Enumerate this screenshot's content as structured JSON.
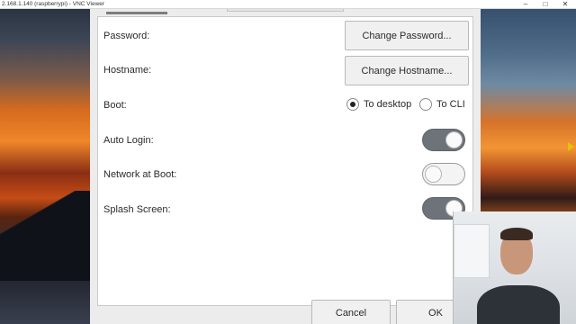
{
  "window": {
    "title": "2.168.1.140 (raspberrypi) - VNC Viewer",
    "minimize": "–",
    "maximize": "□",
    "close": "✕"
  },
  "settings": {
    "password_label": "Password:",
    "password_button": "Change Password...",
    "hostname_label": "Hostname:",
    "hostname_button": "Change Hostname...",
    "boot_label": "Boot:",
    "boot_options": [
      {
        "label": "To desktop",
        "selected": true
      },
      {
        "label": "To CLI",
        "selected": false
      }
    ],
    "auto_login_label": "Auto Login:",
    "auto_login": true,
    "network_boot_label": "Network at Boot:",
    "network_boot": false,
    "splash_label": "Splash Screen:",
    "splash": true
  },
  "footer": {
    "cancel_label": "Cancel",
    "ok_label": "OK"
  }
}
